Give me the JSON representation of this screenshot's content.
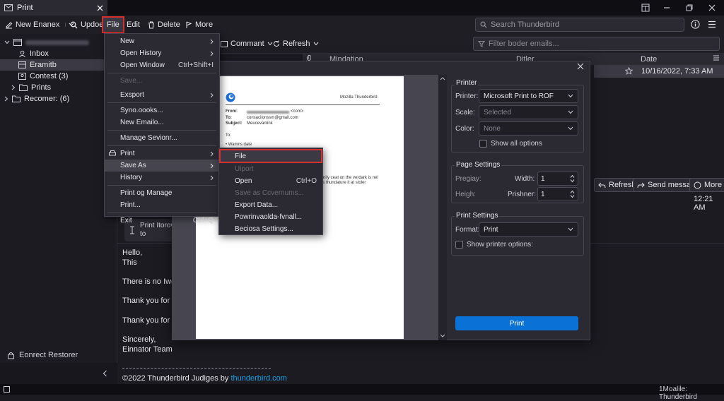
{
  "window": {
    "tab_title": "Print"
  },
  "toolbar": {
    "new_label": "New Enanex",
    "update_label": "Updoek",
    "file_label": "File",
    "edit_label": "Edit",
    "delete_label": "Delete",
    "more_label": "More",
    "search_placeholder": "Search Thunderbird"
  },
  "sidebar": {
    "folders": [
      {
        "label": "Inbox"
      },
      {
        "label": "Eramitb"
      },
      {
        "label": "Contest (3)"
      },
      {
        "label": "Prints"
      },
      {
        "label": "Recomer: (6)"
      }
    ],
    "footer_label": "Eonrect Restorer"
  },
  "list": {
    "comment_label": "Commant",
    "refresh_label": "Refresh",
    "filter_placeholder": "Filter boder emails...",
    "columns": {
      "col1": "Mipdation",
      "col2": "Ditler",
      "date": "Date"
    },
    "row_date": "10/16/2022, 7:33 AM"
  },
  "message": {
    "refresh_btn": "Refresh",
    "send_btn": "Send message",
    "more_btn": "More",
    "time": "12:21 AM",
    "notice_line1": "Print Itorov",
    "notice_line2": "to",
    "body": [
      "Hello,",
      "This",
      "There is no Iwoo",
      "Thank you for s",
      "Thank you for h",
      "Sincerely,",
      "Einnator Team"
    ],
    "footer_prefix": "©2022 Thunderbird Judiges by ",
    "footer_link": "thunderbird.com",
    "link_color": "#1aa0e6"
  },
  "file_menu": {
    "items": [
      {
        "label": "New",
        "shortcut": "",
        "submenu": true,
        "enabled": true
      },
      {
        "label": "Open History",
        "shortcut": "",
        "submenu": true,
        "enabled": true
      },
      {
        "label": "Open Window",
        "shortcut": "Ctrl+Shift+I",
        "submenu": false,
        "enabled": true
      },
      {
        "label": "Save...",
        "shortcut": "",
        "submenu": false,
        "enabled": false
      },
      {
        "label": "Exsport",
        "shortcut": "",
        "submenu": true,
        "enabled": true
      },
      {
        "label": "Syno.oooks...",
        "shortcut": "",
        "submenu": false,
        "enabled": true
      },
      {
        "label": "New Emailo...",
        "shortcut": "",
        "submenu": false,
        "enabled": true
      },
      {
        "label": "Manage Sevionr...",
        "shortcut": "",
        "submenu": false,
        "enabled": true
      },
      {
        "label": "Print",
        "shortcut": "",
        "submenu": true,
        "enabled": true
      },
      {
        "label": "Save As",
        "shortcut": "",
        "submenu": true,
        "enabled": true
      },
      {
        "label": "History",
        "shortcut": "",
        "submenu": true,
        "enabled": true
      },
      {
        "label": "Print og Manage",
        "shortcut": "",
        "submenu": false,
        "enabled": true
      },
      {
        "label": "Print...",
        "shortcut": "",
        "submenu": false,
        "enabled": true
      },
      {
        "label": "Exit",
        "shortcut": "Ctrl+Q",
        "submenu": false,
        "enabled": true
      }
    ]
  },
  "saveas_menu": {
    "items": [
      {
        "label": "File",
        "shortcut": "",
        "enabled": true
      },
      {
        "label": "Uiport",
        "shortcut": "",
        "enabled": false
      },
      {
        "label": "Open",
        "shortcut": "Ctrl+O",
        "enabled": true
      },
      {
        "label": "Save as Ccvernums...",
        "shortcut": "",
        "enabled": false
      },
      {
        "label": "Export Data...",
        "shortcut": "",
        "enabled": true
      },
      {
        "label": "Powrinvaolda-fvnall...",
        "shortcut": "",
        "enabled": true
      },
      {
        "label": "Beciosa Settings...",
        "shortcut": "",
        "enabled": true
      }
    ]
  },
  "print_preview": {
    "brand": "Mozilla Thunderbird",
    "from_label": "From:",
    "from_value": "<com>",
    "to_label": "To:",
    "to_value": "consaciionssm@gmail.com",
    "subject_label": "Subject:",
    "subject_value": "Meucevanlink",
    "to2": "To:",
    "bullet": "• Wamns date",
    "snippet1": "rnily ceat on the verdark is nel",
    "snippet2": "ls thundature it at stoler"
  },
  "print_panel": {
    "printer_group": "Printer",
    "printer_label": "Printer:",
    "printer_value": "Microsoft Print to ROF",
    "scale_label": "Scale:",
    "scale_value": "Selected",
    "color_label": "Color:",
    "color_value": "None",
    "show_all_options": "Show all options",
    "page_group": "Page Settings",
    "pregiay_label": "Pregiay:",
    "width_label": "Width:",
    "width_value": "1",
    "height_label": "Heigh:",
    "prishner_label": "Prishner:",
    "prishner_value": "1",
    "print_settings_group": "Print Settings",
    "format_label": "Format:",
    "format_value": "Print",
    "show_printer_options": "Show printer options:",
    "print_button": "Print"
  },
  "status": {
    "right_text": "1Moalile: Thunderbird"
  },
  "colors": {
    "accent": "#0a72d6",
    "highlight": "#d62f2f"
  }
}
